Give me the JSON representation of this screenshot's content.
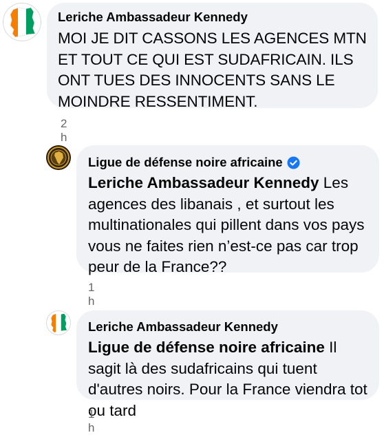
{
  "comments": [
    {
      "author": "Leriche Ambassadeur Kennedy",
      "avatar_icon": "ivory-coast-map-icon",
      "mention": "",
      "text": "MOI JE DIT CASSONS LES AGENCES MTN ET TOUT CE QUI EST SUDAFRICAIN. ILS ONT TUES DES INNOCENTS SANS LE MOINDRE RESSENTIMENT.",
      "time": "2 h",
      "verified": false
    },
    {
      "author": "Ligue de défense noire africaine",
      "avatar_icon": "ligue-seal-icon",
      "mention": "Leriche Ambassadeur Kennedy",
      "text": " Les agences des libanais , et surtout les multinationales qui pillent dans vos pays vous ne faites rien n’est-ce pas car trop peur de la France??",
      "time": "1 h",
      "verified": true,
      "verified_icon": "verified-badge-icon"
    },
    {
      "author": "Leriche Ambassadeur Kennedy",
      "avatar_icon": "ivory-coast-map-icon",
      "mention": "Ligue de défense noire africaine",
      "text": " Il sagit là des sudafricains qui tuent d'autres noirs. Pour la France viendra tot ou tard",
      "time": "1 h",
      "verified": false
    }
  ],
  "colors": {
    "bubble": "#f0f2f5",
    "text": "#050505",
    "meta": "#65676b",
    "verified": "#1877f2",
    "flag_orange": "#f77f00",
    "flag_green": "#009e60"
  }
}
